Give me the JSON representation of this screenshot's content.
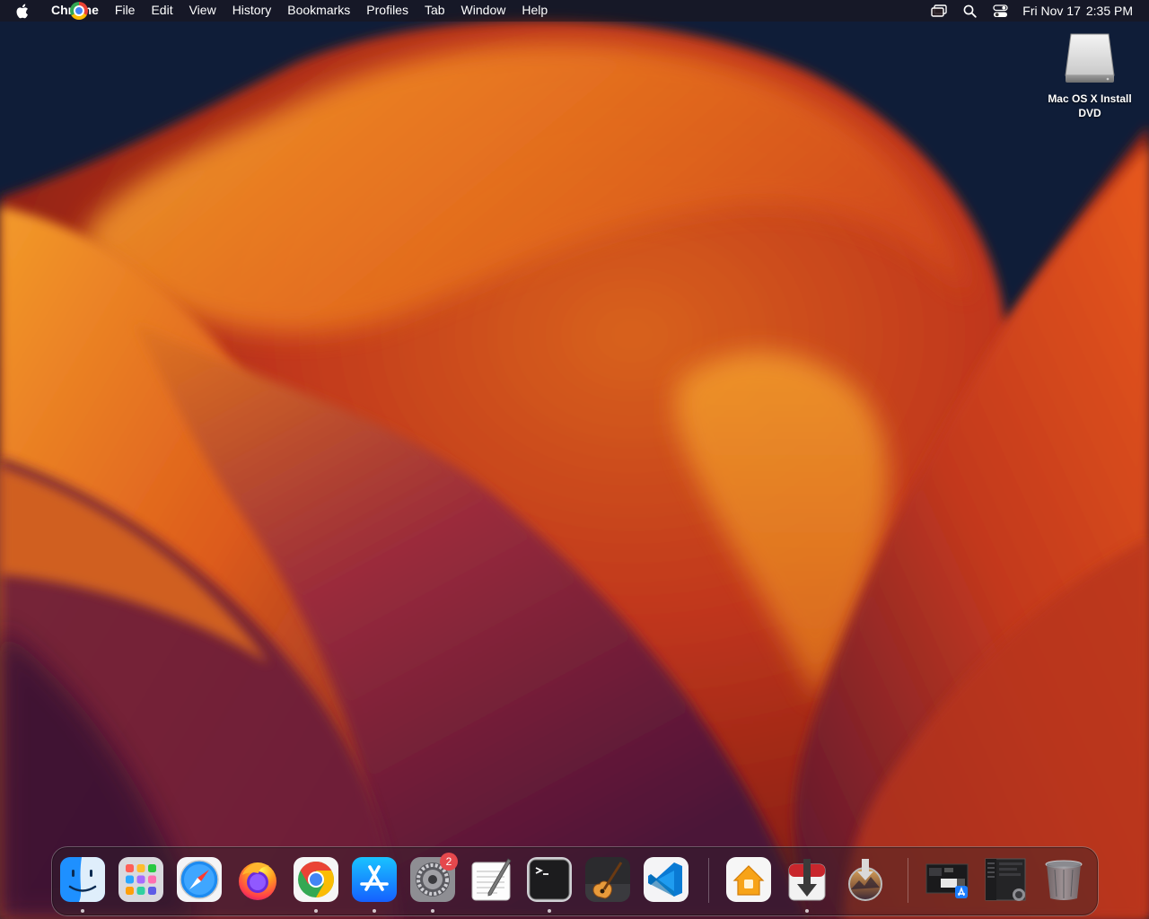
{
  "menubar": {
    "app_name": "Chrome",
    "menus": [
      "File",
      "Edit",
      "View",
      "History",
      "Bookmarks",
      "Profiles",
      "Tab",
      "Window",
      "Help"
    ],
    "status_icons": [
      "screen-mirroring-icon",
      "spotlight-search-icon",
      "control-center-icon"
    ],
    "clock": {
      "day_date": "Fri Nov 17",
      "time": "2:35 PM"
    }
  },
  "desktop": {
    "wallpaper": "macos-ventura-orange",
    "icons": [
      {
        "name": "drive-icon",
        "label": "Mac OS X Install DVD"
      }
    ]
  },
  "dock": {
    "apps": [
      {
        "name": "finder",
        "running": true
      },
      {
        "name": "launchpad",
        "running": false
      },
      {
        "name": "safari",
        "running": false
      },
      {
        "name": "firefox",
        "running": false
      },
      {
        "name": "google-chrome",
        "running": true
      },
      {
        "name": "app-store",
        "running": true
      },
      {
        "name": "system-settings",
        "running": true,
        "badge": "2"
      },
      {
        "name": "textedit",
        "running": false
      },
      {
        "name": "terminal",
        "running": true
      },
      {
        "name": "garageband",
        "running": false
      },
      {
        "name": "visual-studio-code",
        "running": false
      },
      {
        "name": "home",
        "running": false
      },
      {
        "name": "transmit-download",
        "running": true
      },
      {
        "name": "macos-installer",
        "running": false
      }
    ],
    "stacks": [
      "downloads-stack",
      "recent-window-stack"
    ],
    "trash": "trash-icon",
    "colors": {
      "badge": "#e5484d",
      "accent": "#0a84ff"
    }
  }
}
